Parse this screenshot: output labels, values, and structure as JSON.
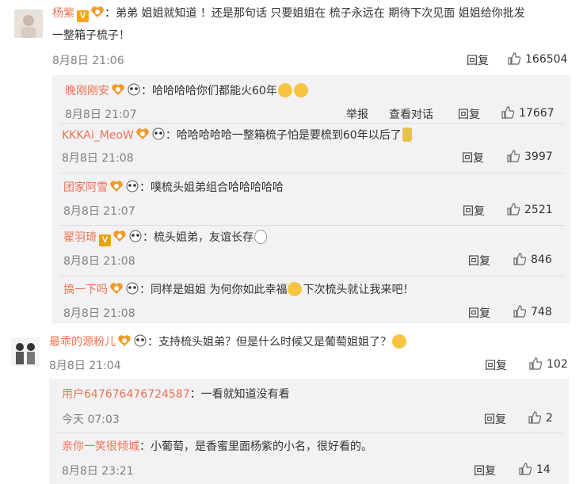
{
  "comments": [
    {
      "user": "杨紫",
      "text_line1": "：弟弟 姐姐就知道 ！还是那句话 只要姐姐在 梳子永远在 期待下次见面 姐姐给你批发",
      "text_line2": "一整箱子梳子！",
      "time": "8月8日 21:06",
      "reply": "回复",
      "likes": "166504",
      "replies": [
        {
          "user": "晚刚刚安",
          "text": "：哈哈哈哈你们都能火60年",
          "time": "8月8日 21:07",
          "report": "举报",
          "view": "查看对话",
          "reply": "回复",
          "likes": "17667"
        },
        {
          "user": "KKKAi_MeoW",
          "text": "：哈哈哈哈哈一整箱梳子怕是要梳到60年以后了",
          "time": "8月8日 21:08",
          "reply": "回复",
          "likes": "3997"
        },
        {
          "user": "团家阿雪",
          "text": "：噗梳头姐弟组合哈哈哈哈哈",
          "time": "8月8日 21:07",
          "reply": "回复",
          "likes": "2521"
        },
        {
          "user": "翟羽琦",
          "text": "：梳头姐弟，友谊长存",
          "time": "8月8日 21:08",
          "reply": "回复",
          "likes": "846"
        },
        {
          "user": "搞一下吗",
          "text": "：同样是姐姐 为何你如此幸福",
          "text2": "下次梳头就让我来吧！",
          "time": "8月8日 21:08",
          "reply": "回复",
          "likes": "748"
        }
      ]
    },
    {
      "user": "最乖的源粉儿",
      "text": "：支持梳头姐弟？但是什么时候又是葡萄姐姐了？",
      "time": "8月8日 21:04",
      "reply": "回复",
      "likes": "102",
      "replies": [
        {
          "user": "用户6476764767245​87",
          "text": "：一看就知道没有看",
          "time": "今天 07:03",
          "reply": "回复",
          "likes": "2"
        },
        {
          "user": "亲你一笑很倾城",
          "text": "：小葡萄，是香蜜里面杨紫的小名，很好看的。",
          "time": "8月8日 23:21",
          "reply": "回复",
          "likes": "14"
        }
      ]
    }
  ]
}
